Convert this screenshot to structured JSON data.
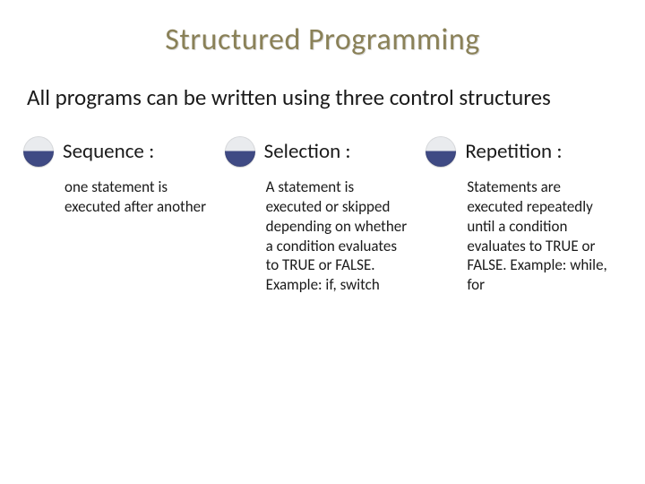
{
  "title": "Structured Programming",
  "intro": "All programs can be written using three control structures",
  "columns": [
    {
      "heading": "Sequence :",
      "body": "one statement is executed after another"
    },
    {
      "heading": "Selection :",
      "body": "A statement is executed or skipped depending on whether a condition evaluates to TRUE or FALSE. Example: if, switch"
    },
    {
      "heading": "Repetition :",
      "body": "Statements are executed repeatedly until a condition evaluates to TRUE or FALSE. Example: while, for"
    }
  ]
}
